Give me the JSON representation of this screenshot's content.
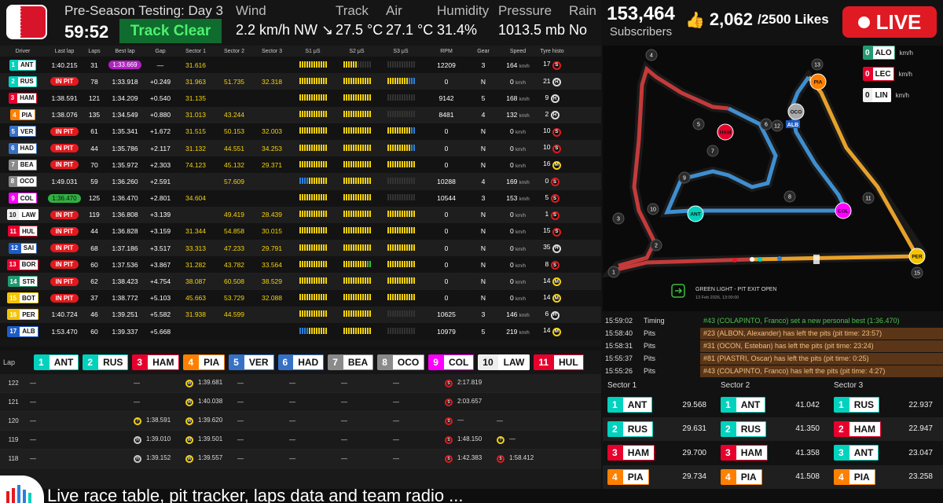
{
  "session": {
    "title": "Pre-Season Testing: Day 3",
    "clock": "59:52",
    "track_status": "Track Clear"
  },
  "weather": [
    {
      "label": "Wind",
      "value": "2.2 km/h NW ↘"
    },
    {
      "label": "Track",
      "value": "27.5 °C"
    },
    {
      "label": "Air",
      "value": "27.1 °C"
    },
    {
      "label": "Humidity",
      "value": "31.4%"
    },
    {
      "label": "Pressure",
      "value": "1013.5 mb"
    },
    {
      "label": "Rain",
      "value": "No"
    }
  ],
  "stream": {
    "subscribers": "153,464",
    "subscribers_label": "Subscribers",
    "likes": "2,062",
    "likes_goal": "/2500 Likes",
    "live_label": "LIVE"
  },
  "columns": [
    "Driver",
    "Last lap",
    "Laps",
    "Best lap",
    "Gap",
    "Sector 1",
    "Sector 2",
    "Sector 3",
    "S1 μS",
    "S2 μS",
    "S3 μS",
    "RPM",
    "Gear",
    "Speed",
    "Tyre histo"
  ],
  "drivers": [
    {
      "pos": "1",
      "code": "ANT",
      "color": "#00d2be",
      "last": "1:40.215",
      "laps": "31",
      "best": "1:33.669",
      "gap": "—",
      "s1": "31.616",
      "s2": "",
      "s3": "",
      "rpm": "12209",
      "gear": "3",
      "speed": "164",
      "tyre": "S",
      "tyres": "17"
    },
    {
      "pos": "2",
      "code": "RUS",
      "color": "#00d2be",
      "last": "IN PIT",
      "laps": "78",
      "best": "1:33.918",
      "gap": "+0.249",
      "s1": "31.963",
      "s2": "51.735",
      "s3": "32.318",
      "rpm": "0",
      "gear": "N",
      "speed": "0",
      "tyre": "H",
      "tyres": "21"
    },
    {
      "pos": "3",
      "code": "HAM",
      "color": "#e8002d",
      "last": "1:38.591",
      "laps": "121",
      "best": "1:34.209",
      "gap": "+0.540",
      "s1": "31.135",
      "s2": "",
      "s3": "",
      "rpm": "9142",
      "gear": "5",
      "speed": "168",
      "tyre": "H",
      "tyres": "9"
    },
    {
      "pos": "4",
      "code": "PIA",
      "color": "#ff8000",
      "last": "1:38.076",
      "laps": "135",
      "best": "1:34.549",
      "gap": "+0.880",
      "s1": "31.013",
      "s2": "43.244",
      "s3": "",
      "rpm": "8481",
      "gear": "4",
      "speed": "132",
      "tyre": "H",
      "tyres": "2"
    },
    {
      "pos": "5",
      "code": "VER",
      "color": "#3671c6",
      "last": "IN PIT",
      "laps": "61",
      "best": "1:35.341",
      "gap": "+1.672",
      "s1": "31.515",
      "s2": "50.153",
      "s3": "32.003",
      "rpm": "0",
      "gear": "N",
      "speed": "0",
      "tyre": "S",
      "tyres": "10"
    },
    {
      "pos": "6",
      "code": "HAD",
      "color": "#3671c6",
      "last": "IN PIT",
      "laps": "44",
      "best": "1:35.786",
      "gap": "+2.117",
      "s1": "31.132",
      "s2": "44.551",
      "s3": "34.253",
      "rpm": "0",
      "gear": "N",
      "speed": "0",
      "tyre": "S",
      "tyres": "10"
    },
    {
      "pos": "7",
      "code": "BEA",
      "color": "#8a8a8a",
      "last": "IN PIT",
      "laps": "70",
      "best": "1:35.972",
      "gap": "+2.303",
      "s1": "74.123",
      "s2": "45.132",
      "s3": "29.371",
      "rpm": "0",
      "gear": "N",
      "speed": "0",
      "tyre": "M",
      "tyres": "16"
    },
    {
      "pos": "8",
      "code": "OCO",
      "color": "#8a8a8a",
      "last": "1:49.031",
      "laps": "59",
      "best": "1:36.260",
      "gap": "+2.591",
      "s1": "",
      "s2": "57.609",
      "s3": "",
      "rpm": "10288",
      "gear": "4",
      "speed": "169",
      "tyre": "S",
      "tyres": "0"
    },
    {
      "pos": "9",
      "code": "COL",
      "color": "#ff00ff",
      "last": "1:36.470",
      "laps": "125",
      "best": "1:36.470",
      "gap": "+2.801",
      "s1": "34.604",
      "s2": "",
      "s3": "",
      "rpm": "10544",
      "gear": "3",
      "speed": "153",
      "tyre": "S",
      "tyres": "5"
    },
    {
      "pos": "10",
      "code": "LAW",
      "color": "#ffffff",
      "last": "IN PIT",
      "laps": "119",
      "best": "1:36.808",
      "gap": "+3.139",
      "s1": "",
      "s2": "49.419",
      "s3": "28.439",
      "rpm": "0",
      "gear": "N",
      "speed": "0",
      "tyre": "S",
      "tyres": "1"
    },
    {
      "pos": "11",
      "code": "HUL",
      "color": "#e8002d",
      "last": "IN PIT",
      "laps": "44",
      "best": "1:36.828",
      "gap": "+3.159",
      "s1": "31.344",
      "s2": "54.858",
      "s3": "30.015",
      "rpm": "0",
      "gear": "N",
      "speed": "0",
      "tyre": "S",
      "tyres": "15"
    },
    {
      "pos": "12",
      "code": "SAI",
      "color": "#1e5bc6",
      "last": "IN PIT",
      "laps": "68",
      "best": "1:37.186",
      "gap": "+3.517",
      "s1": "33.313",
      "s2": "47.233",
      "s3": "29.791",
      "rpm": "0",
      "gear": "N",
      "speed": "0",
      "tyre": "H",
      "tyres": "35"
    },
    {
      "pos": "13",
      "code": "BOR",
      "color": "#e8002d",
      "last": "IN PIT",
      "laps": "60",
      "best": "1:37.536",
      "gap": "+3.867",
      "s1": "31.282",
      "s2": "43.782",
      "s3": "33.564",
      "rpm": "0",
      "gear": "N",
      "speed": "0",
      "tyre": "S",
      "tyres": "8"
    },
    {
      "pos": "14",
      "code": "STR",
      "color": "#229971",
      "last": "IN PIT",
      "laps": "62",
      "best": "1:38.423",
      "gap": "+4.754",
      "s1": "38.087",
      "s2": "60.508",
      "s3": "38.529",
      "rpm": "0",
      "gear": "N",
      "speed": "0",
      "tyre": "M",
      "tyres": "14"
    },
    {
      "pos": "15",
      "code": "BOT",
      "color": "#f5c400",
      "last": "IN PIT",
      "laps": "37",
      "best": "1:38.772",
      "gap": "+5.103",
      "s1": "45.663",
      "s2": "53.729",
      "s3": "32.088",
      "rpm": "0",
      "gear": "N",
      "speed": "0",
      "tyre": "M",
      "tyres": "14"
    },
    {
      "pos": "16",
      "code": "PER",
      "color": "#f5c400",
      "last": "1:40.724",
      "laps": "46",
      "best": "1:39.251",
      "gap": "+5.582",
      "s1": "31.938",
      "s2": "44.599",
      "s3": "",
      "rpm": "10625",
      "gear": "3",
      "speed": "146",
      "tyre": "H",
      "tyres": "6"
    },
    {
      "pos": "17",
      "code": "ALB",
      "color": "#1e5bc6",
      "last": "1:53.470",
      "laps": "60",
      "best": "1:39.337",
      "gap": "+5.668",
      "s1": "",
      "s2": "",
      "s3": "",
      "rpm": "10979",
      "gear": "5",
      "speed": "219",
      "tyre": "M",
      "tyres": "14"
    }
  ],
  "speed_unit": "km/h",
  "lap_header": {
    "label": "Lap",
    "drivers": [
      {
        "pos": "1",
        "code": "ANT",
        "color": "#00d2be"
      },
      {
        "pos": "2",
        "code": "RUS",
        "color": "#00d2be"
      },
      {
        "pos": "3",
        "code": "HAM",
        "color": "#e8002d"
      },
      {
        "pos": "4",
        "code": "PIA",
        "color": "#ff8000"
      },
      {
        "pos": "5",
        "code": "VER",
        "color": "#3671c6"
      },
      {
        "pos": "6",
        "code": "HAD",
        "color": "#3671c6"
      },
      {
        "pos": "7",
        "code": "BEA",
        "color": "#8a8a8a"
      },
      {
        "pos": "8",
        "code": "OCO",
        "color": "#8a8a8a"
      },
      {
        "pos": "9",
        "code": "COL",
        "color": "#ff00ff"
      },
      {
        "pos": "10",
        "code": "LAW",
        "color": "#ffffff"
      },
      {
        "pos": "11",
        "code": "HUL",
        "color": "#e8002d"
      }
    ]
  },
  "lap_rows": [
    {
      "lap": "122",
      "cells": [
        "—",
        "",
        "—",
        "M|1:39.681",
        "—",
        "—",
        "—",
        "—",
        "S|2:17.819",
        "",
        ""
      ]
    },
    {
      "lap": "121",
      "cells": [
        "—",
        "",
        "—",
        "M|1:40.038",
        "—",
        "—",
        "—",
        "—",
        "S|2:03.657",
        "",
        ""
      ]
    },
    {
      "lap": "120",
      "cells": [
        "—",
        "",
        "?|1:38.591",
        "M|1:39.620",
        "—",
        "—",
        "—",
        "—",
        "S|—",
        "—",
        ""
      ]
    },
    {
      "lap": "119",
      "cells": [
        "—",
        "",
        "H|1:39.010",
        "M|1:39.501",
        "—",
        "—",
        "—",
        "—",
        "S|1:48.150",
        "?|—",
        ""
      ]
    },
    {
      "lap": "118",
      "cells": [
        "—",
        "",
        "H|1:39.152",
        "M|1:39.557",
        "—",
        "—",
        "—",
        "—",
        "S|1:42.383",
        "S|1:58.412",
        ""
      ]
    }
  ],
  "map_legend": [
    {
      "pos": "0",
      "code": "ALO",
      "color": "#229971",
      "unit": "km/h"
    },
    {
      "pos": "0",
      "code": "LEC",
      "color": "#e8002d",
      "unit": "km/h"
    },
    {
      "pos": "0",
      "code": "LIN",
      "color": "#ffffff",
      "unit": "km/h"
    }
  ],
  "map_labels": {
    "status": "GREEN LIGHT - PIT EXIT OPEN",
    "date": "13 Feb 2026, 13:00:00"
  },
  "map_cars": [
    {
      "code": "ANT",
      "color": "#00d2be"
    },
    {
      "code": "HAM",
      "color": "#e8002d"
    },
    {
      "code": "PIA",
      "color": "#ff8000"
    },
    {
      "code": "OCO",
      "color": "#aaaaaa"
    },
    {
      "code": "ALB",
      "color": "#1e5bc6"
    },
    {
      "code": "COL",
      "color": "#ff00ff"
    },
    {
      "code": "PER",
      "color": "#f5c400"
    }
  ],
  "turns": [
    "1",
    "2",
    "3",
    "4",
    "5",
    "6",
    "7",
    "8",
    "9",
    "10",
    "11",
    "12",
    "13",
    "15"
  ],
  "events": [
    {
      "time": "15:59:02",
      "kind": "Timing",
      "msg": "#43 (COLAPINTO, Franco) set a new personal best (1:36.470)",
      "style": "g"
    },
    {
      "time": "15:58:40",
      "kind": "Pits",
      "msg": "#23 (ALBON, Alexander) has left the pits (pit time: 23:57)",
      "style": "p"
    },
    {
      "time": "15:58:31",
      "kind": "Pits",
      "msg": "#31 (OCON, Esteban) has left the pits (pit time: 23:24)",
      "style": "p"
    },
    {
      "time": "15:55:37",
      "kind": "Pits",
      "msg": "#81 (PIASTRI, Oscar) has left the pits (pit time: 0:25)",
      "style": "p"
    },
    {
      "time": "15:55:26",
      "kind": "Pits",
      "msg": "#43 (COLAPINTO, Franco) has left the pits (pit time: 4:27)",
      "style": "p"
    }
  ],
  "sectors": {
    "headers": [
      "Sector 1",
      "Sector 2",
      "Sector 3"
    ],
    "rows": [
      [
        {
          "pos": "1",
          "code": "ANT",
          "color": "#00d2be",
          "v": "29.568"
        },
        {
          "pos": "1",
          "code": "ANT",
          "color": "#00d2be",
          "v": "41.042"
        },
        {
          "pos": "1",
          "code": "RUS",
          "color": "#00d2be",
          "v": "22.937"
        }
      ],
      [
        {
          "pos": "2",
          "code": "RUS",
          "color": "#00d2be",
          "v": "29.631"
        },
        {
          "pos": "2",
          "code": "RUS",
          "color": "#00d2be",
          "v": "41.350"
        },
        {
          "pos": "2",
          "code": "HAM",
          "color": "#e8002d",
          "v": "22.947"
        }
      ],
      [
        {
          "pos": "3",
          "code": "HAM",
          "color": "#e8002d",
          "v": "29.700"
        },
        {
          "pos": "3",
          "code": "HAM",
          "color": "#e8002d",
          "v": "41.358"
        },
        {
          "pos": "3",
          "code": "ANT",
          "color": "#00d2be",
          "v": "23.047"
        }
      ],
      [
        {
          "pos": "4",
          "code": "PIA",
          "color": "#ff8000",
          "v": "29.734"
        },
        {
          "pos": "4",
          "code": "PIA",
          "color": "#ff8000",
          "v": "41.508"
        },
        {
          "pos": "4",
          "code": "PIA",
          "color": "#ff8000",
          "v": "23.258"
        }
      ]
    ]
  },
  "ticker": "Live race table, pit tracker, laps data and team radio ..."
}
